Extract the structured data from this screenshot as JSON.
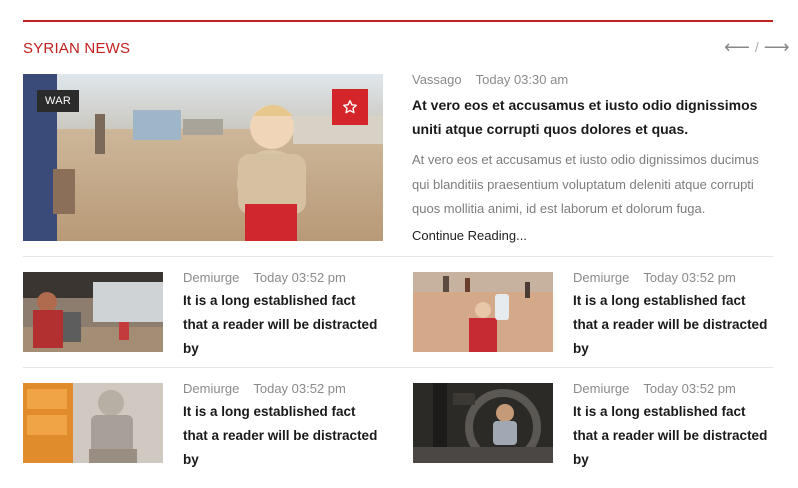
{
  "section": {
    "title": "SYRIAN NEWS",
    "nav_separator": "/"
  },
  "featured": {
    "tag": "WAR",
    "author": "Vassago",
    "date": "Today 03:30 am",
    "title": "At vero eos et accusamus et iusto odio dignissimos uniti atque corrupti quos dolores et quas.",
    "excerpt": "At vero eos et accusamus et iusto odio dignissimos ducimus qui blanditiis praesentium voluptatum deleniti atque corrupti quos mollitia animi, id est laborum et dolorum fuga.",
    "read_more": "Continue Reading..."
  },
  "small_articles": [
    {
      "author": "Demiurge",
      "date": "Today 03:52 pm",
      "title": "It is a long established fact that a reader will be distracted by"
    },
    {
      "author": "Demiurge",
      "date": "Today 03:52 pm",
      "title": "It is a long established fact that a reader will be distracted by"
    },
    {
      "author": "Demiurge",
      "date": "Today 03:52 pm",
      "title": "It is a long established fact that a reader will be distracted by"
    },
    {
      "author": "Demiurge",
      "date": "Today 03:52 pm",
      "title": "It is a long established fact that a reader will be distracted by"
    }
  ],
  "colors": {
    "accent": "#c0201f",
    "star_button": "#d4262a",
    "tag_bg": "#2b2b2b",
    "meta_text": "#8a8a8a"
  },
  "icons": {
    "prev": "arrow-left-icon",
    "next": "arrow-right-icon",
    "favorite": "star-outline-icon"
  }
}
